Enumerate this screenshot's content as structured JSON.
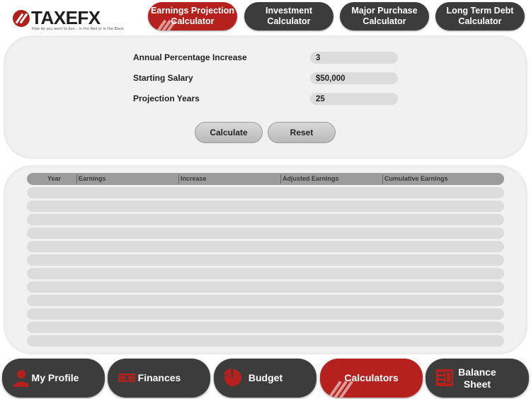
{
  "brand": {
    "name": "TAXEFX",
    "tagline": "How do you want to live... in the Red or in the Black"
  },
  "top_tabs": [
    {
      "label": "Earnings Projection\nCalculator",
      "active": true
    },
    {
      "label": "Investment\nCalculator",
      "active": false
    },
    {
      "label": "Major Purchase\nCalculator",
      "active": false
    },
    {
      "label": "Long Term Debt\nCalculator",
      "active": false
    }
  ],
  "form": {
    "annual_increase": {
      "label": "Annual Percentage Increase",
      "value": "3"
    },
    "starting_salary": {
      "label": "Starting Salary",
      "value": "$50,000"
    },
    "projection_years": {
      "label": "Projection Years",
      "value": "25"
    },
    "calculate_label": "Calculate",
    "reset_label": "Reset"
  },
  "table": {
    "columns": [
      "Year",
      "Earnings",
      "Increase",
      "Adjusted Earnings",
      "Cumulative Earnings"
    ],
    "rows": [
      [],
      [],
      [],
      [],
      [],
      [],
      [],
      [],
      [],
      [],
      [],
      []
    ]
  },
  "bottom_tabs": [
    {
      "label": "My Profile",
      "icon": "person-icon",
      "active": false
    },
    {
      "label": "Finances",
      "icon": "money-icon",
      "active": false
    },
    {
      "label": "Budget",
      "icon": "pie-chart-icon",
      "active": false
    },
    {
      "label": "Calculators",
      "icon": "",
      "active": true
    },
    {
      "label": "Balance\nSheet",
      "icon": "balance-sheet-icon",
      "active": false
    }
  ],
  "colors": {
    "accent": "#b5211c",
    "tab_dark": "#3c3c3c",
    "panel": "#f1f1f1",
    "table_row": "#dcdcdc",
    "table_header": "#9c9c9c"
  }
}
